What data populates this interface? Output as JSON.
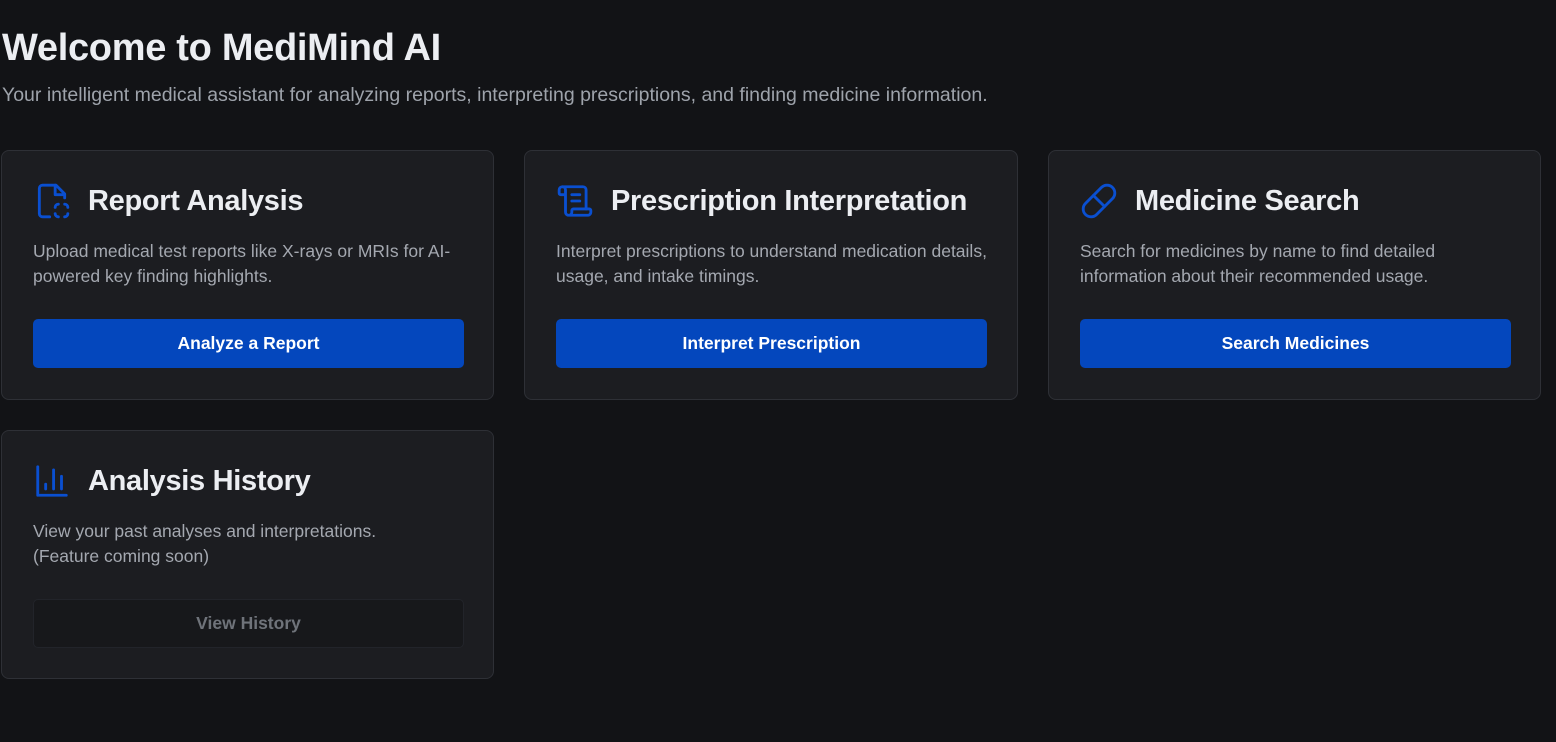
{
  "header": {
    "title": "Welcome to MediMind AI",
    "subtitle": "Your intelligent medical assistant for analyzing reports, interpreting prescriptions, and finding medicine information."
  },
  "theme": {
    "background": "#121316",
    "card_background": "#1c1d21",
    "accent": "#0447bd",
    "icon_color": "#0a4fd0"
  },
  "cards": [
    {
      "icon": "file-scan-icon",
      "title": "Report Analysis",
      "description": "Upload medical test reports like X-rays or MRIs for AI-powered key finding highlights.",
      "button_label": "Analyze a Report",
      "button_enabled": true
    },
    {
      "icon": "scroll-icon",
      "title": "Prescription Interpretation",
      "description": "Interpret prescriptions to understand medication details, usage, and intake timings.",
      "button_label": "Interpret Prescription",
      "button_enabled": true
    },
    {
      "icon": "pill-icon",
      "title": "Medicine Search",
      "description": "Search for medicines by name to find detailed information about their recommended usage.",
      "button_label": "Search Medicines",
      "button_enabled": true
    },
    {
      "icon": "bar-chart-icon",
      "title": "Analysis History",
      "description": "View your past analyses and interpretations. (Feature coming soon)",
      "button_label": "View History",
      "button_enabled": false
    }
  ]
}
